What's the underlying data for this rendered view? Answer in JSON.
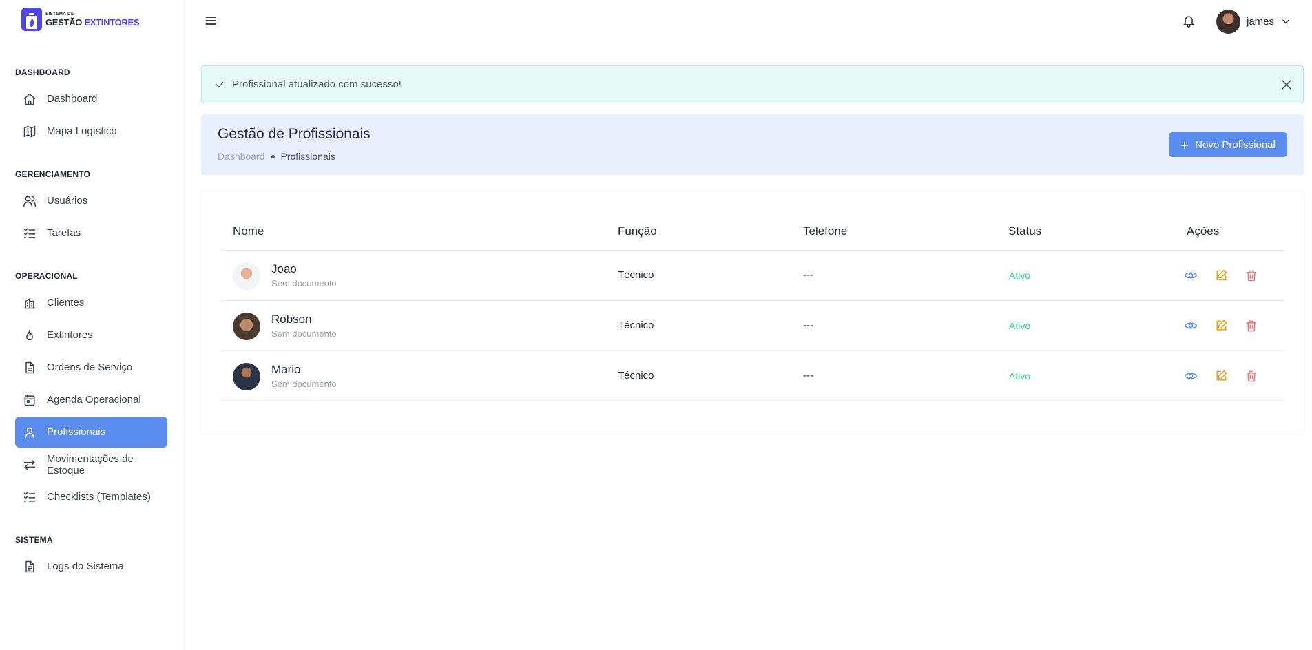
{
  "brand": {
    "small": "SISTEMA DE",
    "main_a": "GESTÃO",
    "main_b": "EXTINTORES"
  },
  "sidebar": {
    "sections": [
      {
        "title": "DASHBOARD"
      },
      {
        "title": "GERENCIAMENTO"
      },
      {
        "title": "OPERACIONAL"
      },
      {
        "title": "SISTEMA"
      }
    ],
    "items": [
      {
        "label": "Dashboard",
        "icon": "home-icon"
      },
      {
        "label": "Mapa Logístico",
        "icon": "map-icon"
      },
      {
        "label": "Usuários",
        "icon": "users-icon"
      },
      {
        "label": "Tarefas",
        "icon": "list-check-icon"
      },
      {
        "label": "Clientes",
        "icon": "building-icon"
      },
      {
        "label": "Extintores",
        "icon": "flame-icon"
      },
      {
        "label": "Ordens de Serviço",
        "icon": "file-icon"
      },
      {
        "label": "Agenda Operacional",
        "icon": "calendar-icon"
      },
      {
        "label": "Profissionais",
        "icon": "user-icon",
        "active": true
      },
      {
        "label": "Movimentações de Estoque",
        "icon": "arrows-icon"
      },
      {
        "label": "Checklists (Templates)",
        "icon": "list-check-icon"
      },
      {
        "label": "Logs do Sistema",
        "icon": "file-text-icon"
      }
    ]
  },
  "topbar": {
    "user_name": "james"
  },
  "alert": {
    "message": "Profissional atualizado com sucesso!"
  },
  "header": {
    "title": "Gestão de Profissionais",
    "breadcrumb_home": "Dashboard",
    "breadcrumb_current": "Profissionais",
    "new_button": "Novo Profissional"
  },
  "table": {
    "columns": [
      "Nome",
      "Função",
      "Telefone",
      "Status",
      "Ações"
    ],
    "rows": [
      {
        "name": "Joao",
        "doc": "Sem documento",
        "role": "Técnico",
        "phone": "---",
        "status": "Ativo"
      },
      {
        "name": "Robson",
        "doc": "Sem documento",
        "role": "Técnico",
        "phone": "---",
        "status": "Ativo"
      },
      {
        "name": "Mario",
        "doc": "Sem documento",
        "role": "Técnico",
        "phone": "---",
        "status": "Ativo"
      }
    ]
  },
  "colors": {
    "accent": "#5b8def",
    "success": "#34d399",
    "edit": "#f59e0b",
    "delete": "#f87171",
    "view": "#5b8def"
  }
}
